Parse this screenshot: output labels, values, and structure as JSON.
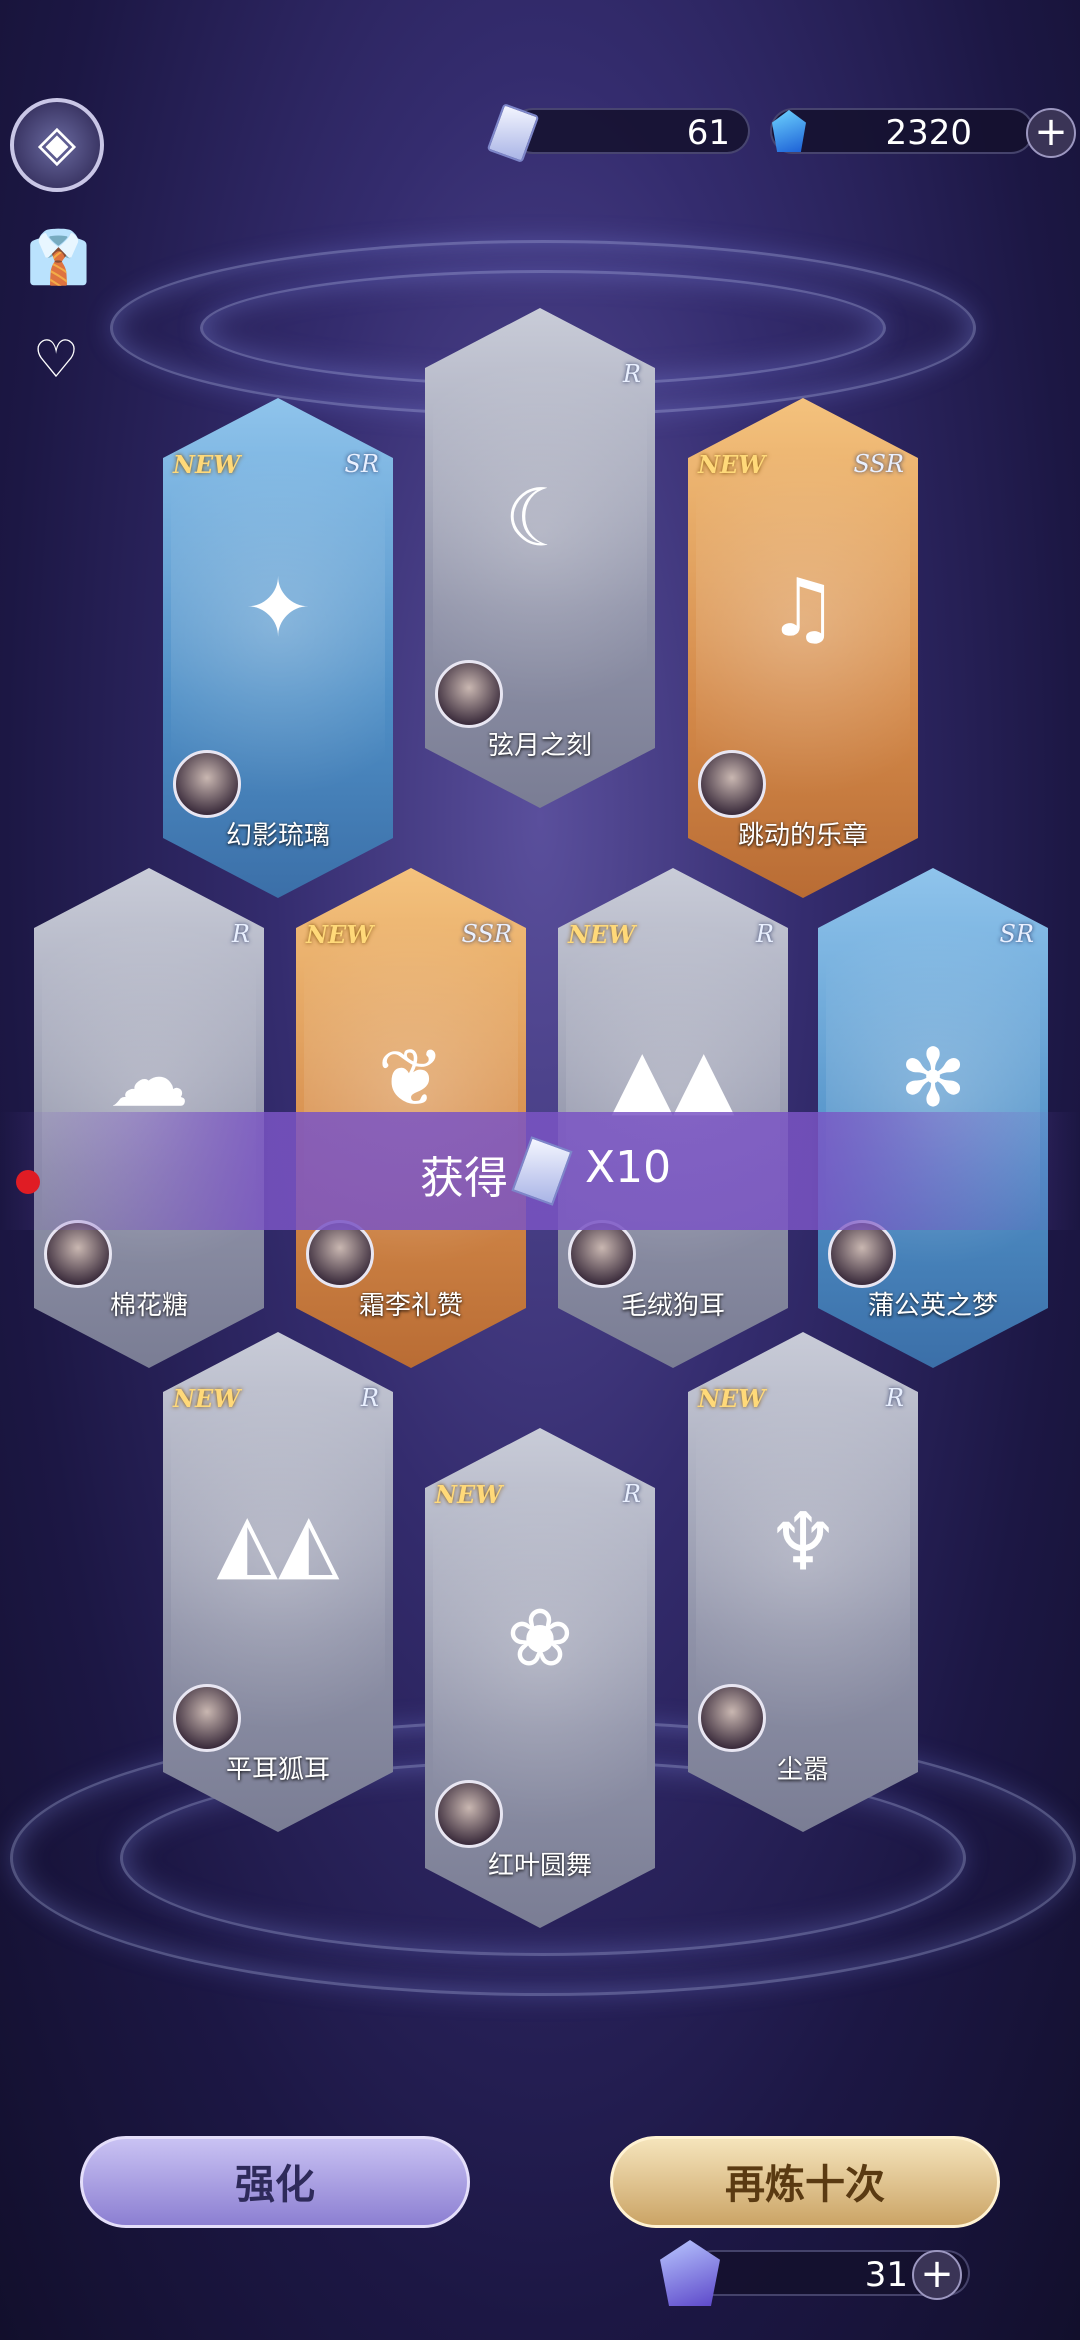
{
  "currency": {
    "tickets": "61",
    "gems": "2320"
  },
  "cards": [
    {
      "name": "幻影琉璃",
      "rarity": "SR",
      "new": "NEW",
      "art": "✦"
    },
    {
      "name": "弦月之刻",
      "rarity": "R",
      "new": "",
      "art": "☾"
    },
    {
      "name": "跳动的乐章",
      "rarity": "SSR",
      "new": "NEW",
      "art": "♫"
    },
    {
      "name": "棉花糖",
      "rarity": "R",
      "new": "",
      "art": "☁"
    },
    {
      "name": "霜李礼赞",
      "rarity": "SSR",
      "new": "NEW",
      "art": "❦"
    },
    {
      "name": "毛绒狗耳",
      "rarity": "R",
      "new": "NEW",
      "art": "▲▲"
    },
    {
      "name": "蒲公英之梦",
      "rarity": "SR",
      "new": "",
      "art": "✻"
    },
    {
      "name": "平耳狐耳",
      "rarity": "R",
      "new": "NEW",
      "art": "◭◭"
    },
    {
      "name": "红叶圆舞",
      "rarity": "R",
      "new": "NEW",
      "art": "❀"
    },
    {
      "name": "尘嚣",
      "rarity": "R",
      "new": "NEW",
      "art": "♆"
    }
  ],
  "banner": {
    "label": "获得",
    "count": "X10"
  },
  "buttons": {
    "enhance": "强化",
    "refine_ten": "再炼十次"
  },
  "refine_cost": "31",
  "rarity_labels": {
    "R": "R",
    "SR": "SR",
    "SSR": "SSR"
  }
}
